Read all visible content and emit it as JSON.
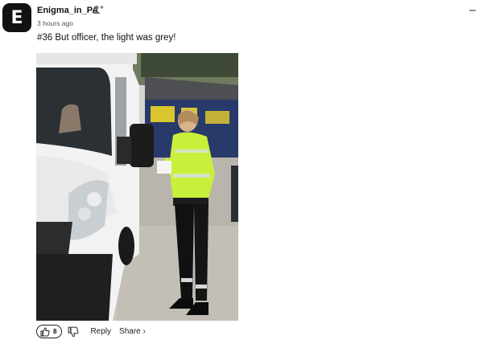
{
  "comment": {
    "avatar_letter": "E",
    "username": "Enigma_in_PA",
    "timestamp": "3 hours ago",
    "text": "#36 But officer, the light was grey!",
    "media_icon": "photo-of-officer-by-van",
    "likes": "8",
    "reply_label": "Reply",
    "share_label": "Share",
    "share_chevron": "›"
  },
  "colors": {
    "avatar_bg": "#121212",
    "hi_vis": "#c8f03a",
    "text": "#111111",
    "muted": "#555555"
  }
}
